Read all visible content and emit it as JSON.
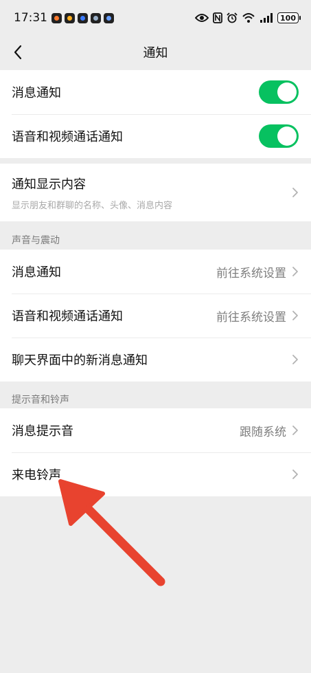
{
  "status_bar": {
    "time": "17:31",
    "battery": "100",
    "notification_app_colors": [
      "#ff7a2f",
      "#ffb020",
      "#3c7cff",
      "#9ab0c8",
      "#6aa0ff"
    ]
  },
  "nav": {
    "title": "通知"
  },
  "group1": {
    "items": [
      {
        "label": "消息通知",
        "toggle_on": true
      },
      {
        "label": "语音和视频通话通知",
        "toggle_on": true
      }
    ]
  },
  "group2": {
    "label": "通知显示内容",
    "subtitle": "显示朋友和群聊的名称、头像、消息内容"
  },
  "section_sound": {
    "header": "声音与震动",
    "items": [
      {
        "label": "消息通知",
        "value": "前往系统设置"
      },
      {
        "label": "语音和视频通话通知",
        "value": "前往系统设置"
      },
      {
        "label": "聊天界面中的新消息通知",
        "value": ""
      }
    ]
  },
  "section_ringtone": {
    "header": "提示音和铃声",
    "items": [
      {
        "label": "消息提示音",
        "value": "跟随系统"
      },
      {
        "label": "来电铃声",
        "value": ""
      }
    ]
  },
  "colors": {
    "accent": "#07c160",
    "annotation_arrow": "#e8432f"
  }
}
